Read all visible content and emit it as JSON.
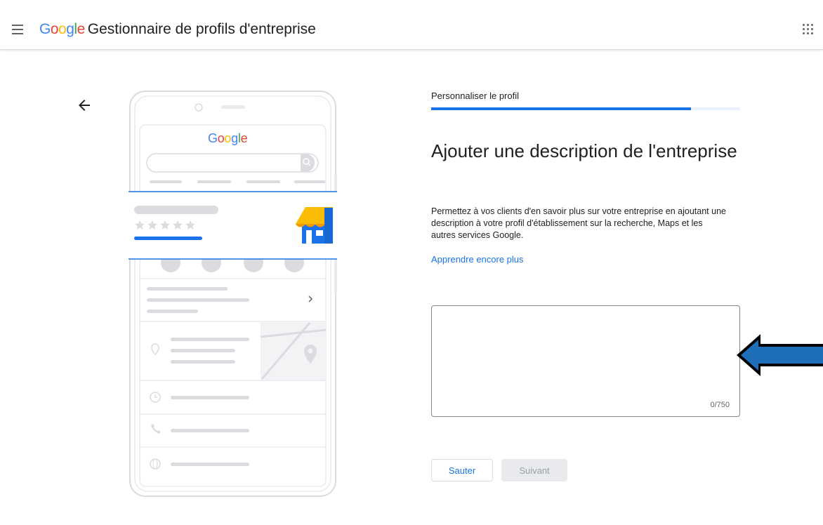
{
  "header": {
    "logo_text": "Google",
    "product_name": "Gestionnaire de profils d'entreprise",
    "menu_icon": "hamburger-menu-icon",
    "apps_icon": "google-apps-grid-icon"
  },
  "navigation": {
    "back_icon": "arrow-back-icon"
  },
  "illustration": {
    "logo_text": "Google",
    "icons": [
      "search-icon",
      "phone-icon",
      "directions-icon",
      "bookmark-icon",
      "website-icon",
      "chevron-right-icon",
      "location-pin-icon",
      "clock-icon",
      "globe-icon",
      "storefront-icon",
      "star-rating-icon"
    ]
  },
  "setup": {
    "step_label": "Personnaliser le profil",
    "progress": 0.84,
    "title": "Ajouter une description de l'entreprise",
    "description": "Permettez à vos clients d'en savoir plus sur votre entreprise en ajoutant une description à votre profil d'établissement sur la recherche, Maps et les autres services Google.",
    "learn_more": "Apprendre encore plus",
    "textarea_value": "",
    "char_counter": "0/750"
  },
  "buttons": {
    "skip": "Sauter",
    "next": "Suivant"
  },
  "colors": {
    "accent": "#1a73e8",
    "callout_arrow": "#1f6fb8",
    "disabled_bg": "#e8eaed"
  }
}
